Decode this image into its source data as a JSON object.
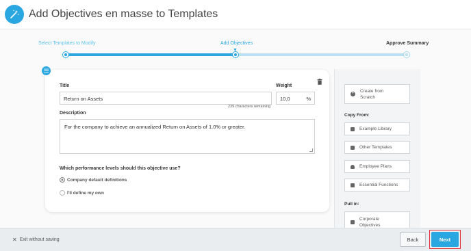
{
  "header": {
    "title": "Add Objectives en masse to Templates",
    "icon": "magic-wand-icon"
  },
  "stepper": {
    "steps": [
      {
        "label": "Select Templates to Modify",
        "state": "completed"
      },
      {
        "label": "Add Objectives",
        "state": "current"
      },
      {
        "label": "Approve Summary",
        "state": "upcoming"
      }
    ]
  },
  "form": {
    "title_label": "Title",
    "title_value": "Return on Assets",
    "chars_remaining": "239 characters remaining",
    "weight_label": "Weight",
    "weight_value": "10.0",
    "weight_unit": "%",
    "description_label": "Description",
    "description_value": "For the company to achieve an annualized Return on Assets of 1.0% or greater.",
    "performance_question": "Which performance levels should this objective use?",
    "options": [
      {
        "label": "Company default definitions",
        "selected": true
      },
      {
        "label": "I'll define my own",
        "selected": false
      }
    ]
  },
  "sidebar": {
    "create_label": "Create from Scratch",
    "copy_from_heading": "Copy From:",
    "copy_from": [
      {
        "label": "Example Library",
        "icon": "book-icon"
      },
      {
        "label": "Other Templates",
        "icon": "template-icon"
      },
      {
        "label": "Employee Plans",
        "icon": "person-icon"
      },
      {
        "label": "Essential Functions",
        "icon": "thumbs-up-icon"
      }
    ],
    "pull_in_heading": "Pull in:",
    "pull_in": [
      {
        "label": "Corporate Objectives",
        "icon": "building-icon"
      }
    ]
  },
  "footer": {
    "exit_label": "Exit without saving",
    "back_label": "Back",
    "next_label": "Next"
  },
  "colors": {
    "accent": "#2aa6e0",
    "highlight": "#e0313b"
  }
}
